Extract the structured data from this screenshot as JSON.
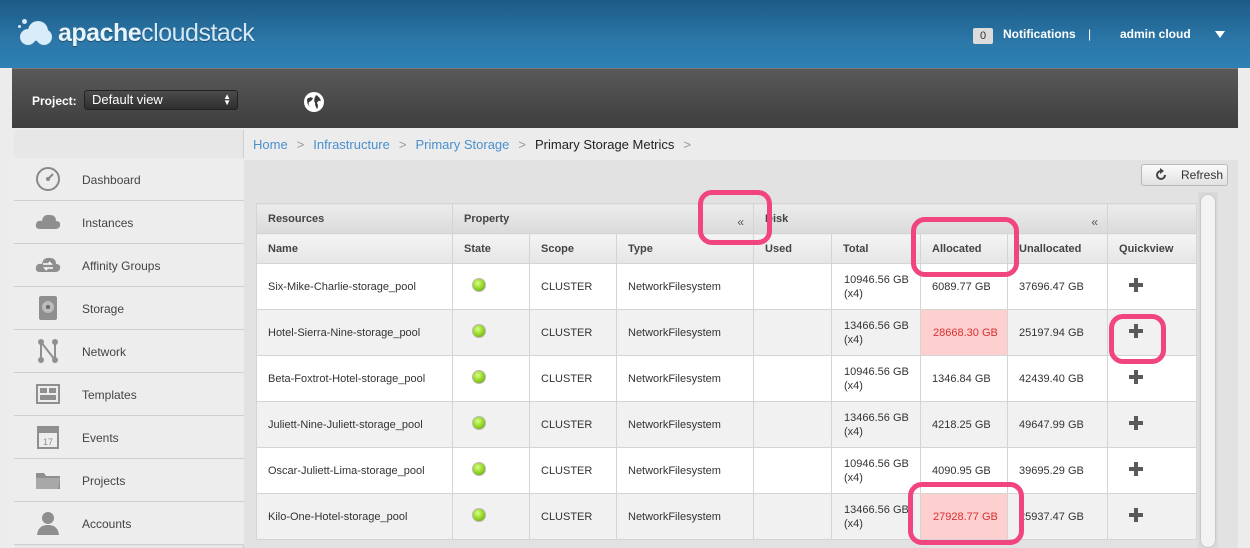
{
  "header": {
    "logo_brand": "apache",
    "logo_product": "cloudstack",
    "notification_count": "0",
    "notifications_label": "Notifications",
    "separator": "|",
    "user_label": "admin cloud"
  },
  "project_bar": {
    "label": "Project:",
    "selected": "Default view"
  },
  "sidebar": {
    "items": [
      {
        "label": "Dashboard",
        "icon": "dashboard-icon"
      },
      {
        "label": "Instances",
        "icon": "cloud-icon"
      },
      {
        "label": "Affinity Groups",
        "icon": "affinity-icon"
      },
      {
        "label": "Storage",
        "icon": "storage-icon"
      },
      {
        "label": "Network",
        "icon": "network-icon"
      },
      {
        "label": "Templates",
        "icon": "templates-icon"
      },
      {
        "label": "Events",
        "icon": "calendar-icon"
      },
      {
        "label": "Projects",
        "icon": "folder-icon"
      },
      {
        "label": "Accounts",
        "icon": "user-icon"
      }
    ]
  },
  "breadcrumb": {
    "home": "Home",
    "infrastructure": "Infrastructure",
    "primary_storage": "Primary Storage",
    "current": "Primary Storage Metrics",
    "sep": ">"
  },
  "toolbar": {
    "refresh_label": "Refresh"
  },
  "table": {
    "groups": {
      "resources": "Resources",
      "property": "Property",
      "disk": "Disk",
      "collapse": "«"
    },
    "columns": {
      "name": "Name",
      "state": "State",
      "scope": "Scope",
      "type": "Type",
      "used": "Used",
      "total": "Total",
      "allocated": "Allocated",
      "unallocated": "Unallocated",
      "quickview": "Quickview"
    },
    "rows": [
      {
        "name": "Six-Mike-Charlie-storage_pool",
        "scope": "CLUSTER",
        "type": "NetworkFilesystem",
        "used": "",
        "total": "10946.56 GB",
        "total_sub": "(x4)",
        "allocated": "6089.77 GB",
        "alloc_hl": false,
        "unallocated": "37696.47 GB"
      },
      {
        "name": "Hotel-Sierra-Nine-storage_pool",
        "scope": "CLUSTER",
        "type": "NetworkFilesystem",
        "used": "",
        "total": "13466.56 GB",
        "total_sub": "(x4)",
        "allocated": "28668.30 GB",
        "alloc_hl": true,
        "unallocated": "25197.94 GB"
      },
      {
        "name": "Beta-Foxtrot-Hotel-storage_pool",
        "scope": "CLUSTER",
        "type": "NetworkFilesystem",
        "used": "",
        "total": "10946.56 GB",
        "total_sub": "(x4)",
        "allocated": "1346.84 GB",
        "alloc_hl": false,
        "unallocated": "42439.40 GB"
      },
      {
        "name": "Juliett-Nine-Juliett-storage_pool",
        "scope": "CLUSTER",
        "type": "NetworkFilesystem",
        "used": "",
        "total": "13466.56 GB",
        "total_sub": "(x4)",
        "allocated": "4218.25 GB",
        "alloc_hl": false,
        "unallocated": "49647.99 GB"
      },
      {
        "name": "Oscar-Juliett-Lima-storage_pool",
        "scope": "CLUSTER",
        "type": "NetworkFilesystem",
        "used": "",
        "total": "10946.56 GB",
        "total_sub": "(x4)",
        "allocated": "4090.95 GB",
        "alloc_hl": false,
        "unallocated": "39695.29 GB"
      },
      {
        "name": "Kilo-One-Hotel-storage_pool",
        "scope": "CLUSTER",
        "type": "NetworkFilesystem",
        "used": "",
        "total": "13466.56 GB",
        "total_sub": "(x4)",
        "allocated": "27928.77 GB",
        "alloc_hl": true,
        "unallocated": "25937.47 GB"
      }
    ]
  },
  "colors": {
    "header_blue": "#2b77a8",
    "link_blue": "#4a90cc",
    "highlight_bg": "#fdcfcf",
    "highlight_text": "#d83030",
    "annotation_pink": "#f0457e",
    "state_green": "#9bdc2a"
  }
}
